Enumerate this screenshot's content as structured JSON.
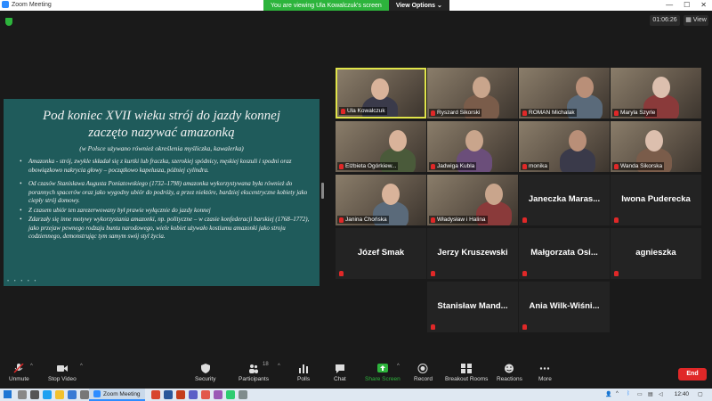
{
  "window": {
    "title": "Zoom Meeting"
  },
  "banner": {
    "message": "You are viewing Ula Kowalczuk's screen",
    "options": "View Options"
  },
  "header": {
    "timer": "01:06:26",
    "view": "View"
  },
  "share": {
    "title_line1": "Pod koniec XVII wieku strój do jazdy konnej",
    "title_line2": "zaczęto nazywać amazonką",
    "subtitle": "(w Polsce używano również określenia myśliczka, kawalerka)",
    "bullets": [
      "Amazonka - strój, zwykle składał się z kurtki lub fraczka, szerokiej spódnicy, męskiej koszuli i spodni oraz obowiązkowo nakrycia głowy – początkowo kapelusza, później cylindra.",
      "Od czasów Stanisława Augusta Poniatowskiego (1732–1798) amazonka wykorzystywana była również do porannych spacerów oraz jako wygodny ubiór do podróży, a przez niektóre, bardziej ekscentryczne kobiety jako ciepły strój domowy.",
      "Z czasem ubiór ten zarezerwowany był prawie wyłącznie do jazdy konnej",
      "Zdarzały się inne motywy wykorzystania amazonki, np. polityczne – w czasie konfederacji barskiej (1768–1772), jako przejaw pewnego rodzaju buntu narodowego, wiele kobiet używało kostiumu amazonki jako stroju codziennego, demonstrując tym samym swój styl życia."
    ],
    "nav_dots": "• • • • •"
  },
  "participants": [
    {
      "name": "Ula Kowalczuk",
      "type": "video",
      "active": true
    },
    {
      "name": "Ryszard Sikorski",
      "type": "video"
    },
    {
      "name": "ROMAN Michalak",
      "type": "video"
    },
    {
      "name": "Maryla Szyrle",
      "type": "video"
    },
    {
      "name": "Elżbieta Ogórkiew...",
      "type": "video"
    },
    {
      "name": "Jadwiga Kubla",
      "type": "video"
    },
    {
      "name": "monika",
      "type": "video"
    },
    {
      "name": "Wanda Sikorska",
      "type": "video"
    },
    {
      "name": "Janina Chońska",
      "type": "video"
    },
    {
      "name": "Władysław i Halina",
      "type": "video"
    },
    {
      "name": "Janeczka Maras...",
      "type": "name"
    },
    {
      "name": "Iwona Puderecka",
      "type": "name"
    },
    {
      "name": "Józef Smak",
      "type": "name"
    },
    {
      "name": "Jerzy Kruszewski",
      "type": "name"
    },
    {
      "name": "Małgorzata Osi...",
      "type": "name"
    },
    {
      "name": "agnieszka",
      "type": "name"
    },
    {
      "name": "Stanisław Mand...",
      "type": "name"
    },
    {
      "name": "Ania Wilk-Wiśni...",
      "type": "name"
    }
  ],
  "toolbar": {
    "unmute": "Unmute",
    "stop_video": "Stop Video",
    "security": "Security",
    "participants": "Participants",
    "participant_count": "18",
    "polls": "Polls",
    "chat": "Chat",
    "share_screen": "Share Screen",
    "record": "Record",
    "breakout": "Breakout Rooms",
    "reactions": "Reactions",
    "more": "More",
    "end": "End"
  },
  "taskbar": {
    "zoom_app": "Zoom Meeting",
    "time": "12:40"
  },
  "colors": {
    "zoom_blue": "#2d8cff",
    "banner_green": "#2db43c",
    "end_red": "#e02828",
    "slide_teal": "#1f5b5b",
    "active_speaker": "#e0e44a"
  }
}
